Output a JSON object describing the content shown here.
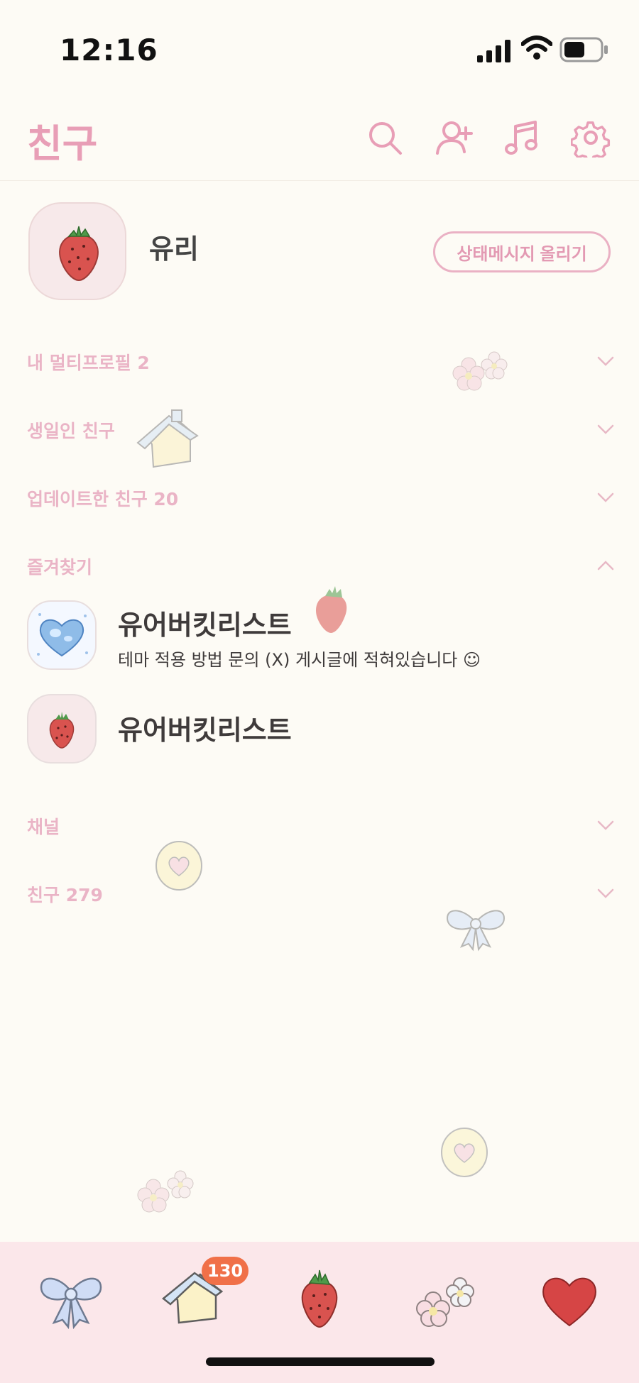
{
  "status_bar": {
    "time": "12:16"
  },
  "header": {
    "title": "친구"
  },
  "profile": {
    "name": "유리",
    "status_button": "상태메시지 올리기"
  },
  "sections": {
    "multi_profile": "내 멀티프로필 2",
    "birthday": "생일인 친구",
    "updated": "업데이트한 친구 20",
    "favorites": "즐겨찾기",
    "channel": "채널",
    "friends": "친구 279"
  },
  "favorites": [
    {
      "name": "유어버킷리스트",
      "message": "테마 적용 방법 문의 (X) 게시글에 적혀있습니다 ☺︎"
    },
    {
      "name": "유어버킷리스트"
    }
  ],
  "tabbar": {
    "badge": "130"
  },
  "colors": {
    "background": "#fdfbf5",
    "accent_pink": "#e89eb6",
    "section_pink": "#eab4c6",
    "tabbar_bg": "#fbe7ea",
    "badge": "#f07048"
  },
  "icons": {
    "header": [
      "search-icon",
      "add-friend-icon",
      "music-icon",
      "settings-icon"
    ],
    "tabbar": [
      "ribbon-icon",
      "house-icon",
      "strawberry-icon",
      "flowers-icon",
      "heart-icon"
    ]
  }
}
